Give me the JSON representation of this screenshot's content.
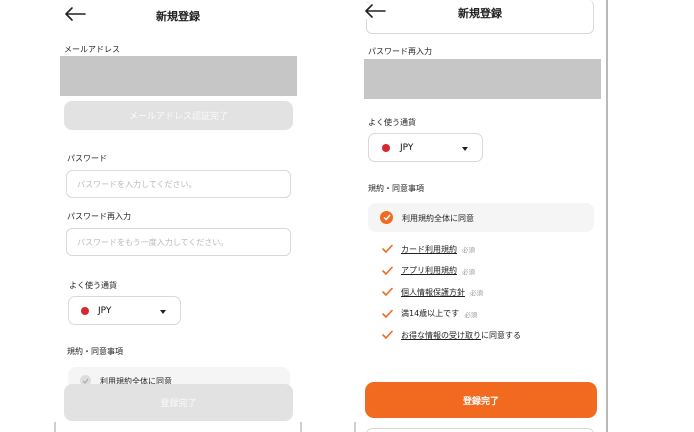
{
  "left_screen": {
    "header": {
      "title": "新規登録"
    },
    "email_label": "メールアドレス",
    "email_verified_button": "メールアドレス認証完了",
    "password_label": "パスワード",
    "password_placeholder": "パスワードを入力してください。",
    "password_confirm_label": "パスワード再入力",
    "password_confirm_placeholder": "パスワードをもう一度入力してください。",
    "currency_label": "よく使う通貨",
    "currency_value": "JPY",
    "terms_label": "規約・同意事項",
    "agree_all": "利用規約全体に同意",
    "agree_all_checked": false,
    "submit_button": "登録完了",
    "submit_enabled": false
  },
  "right_screen": {
    "header": {
      "title": "新規登録"
    },
    "password_confirm_label": "パスワード再入力",
    "currency_label": "よく使う通貨",
    "currency_value": "JPY",
    "terms_label": "規約・同意事項",
    "agree_all": "利用規約全体に同意",
    "agree_all_checked": true,
    "terms": [
      {
        "name": "カード利用規約",
        "badge": "必須",
        "link": true
      },
      {
        "name": "アプリ利用規約",
        "badge": "必須",
        "link": true
      },
      {
        "name": "個人情報保護方針",
        "badge": "必須",
        "link": true
      },
      {
        "name": "満14歳以上です",
        "badge": "必須",
        "link": false
      },
      {
        "name": "お得な情報の受け取り",
        "suffix": "に同意する",
        "link": true
      }
    ],
    "submit_button": "登録完了",
    "submit_enabled": true
  },
  "icons": {
    "back": "back-arrow-icon",
    "currency_flag": "red-dot-icon",
    "dropdown": "caret-down-icon",
    "check": "check-icon"
  },
  "colors": {
    "accent": "#f26a1f",
    "disabled": "#e2e2e2",
    "flag_red": "#d7282f",
    "redaction": "#c6c6c6"
  }
}
